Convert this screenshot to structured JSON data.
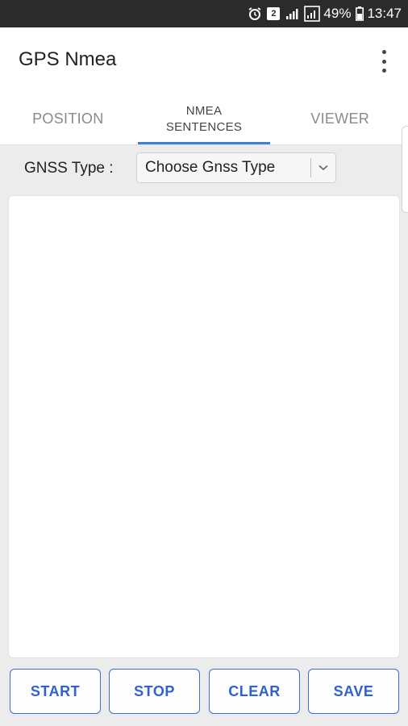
{
  "status_bar": {
    "notification_count": "2",
    "battery": "49%",
    "time": "13:47",
    "icons": [
      "alarm-icon",
      "notification-badge",
      "signal-icon",
      "signal-icon",
      "battery-icon"
    ]
  },
  "app_bar": {
    "title": "GPS Nmea",
    "menu_icon": "overflow-menu-icon"
  },
  "tabs": [
    {
      "label": "POSITION",
      "active": false
    },
    {
      "label_line1": "NMEA",
      "label_line2": "SENTENCES",
      "active": true
    },
    {
      "label": "VIEWER",
      "active": false
    }
  ],
  "gnss": {
    "label": "GNSS Type :",
    "selected": "Choose Gnss Type",
    "icon": "chevron-down-icon"
  },
  "buttons": {
    "start": "START",
    "stop": "STOP",
    "clear": "CLEAR",
    "save": "SAVE"
  },
  "colors": {
    "accent": "#3f7fd6",
    "button_text": "#2f62d0",
    "status_bar": "#2b2b2b",
    "background": "#ececec"
  }
}
